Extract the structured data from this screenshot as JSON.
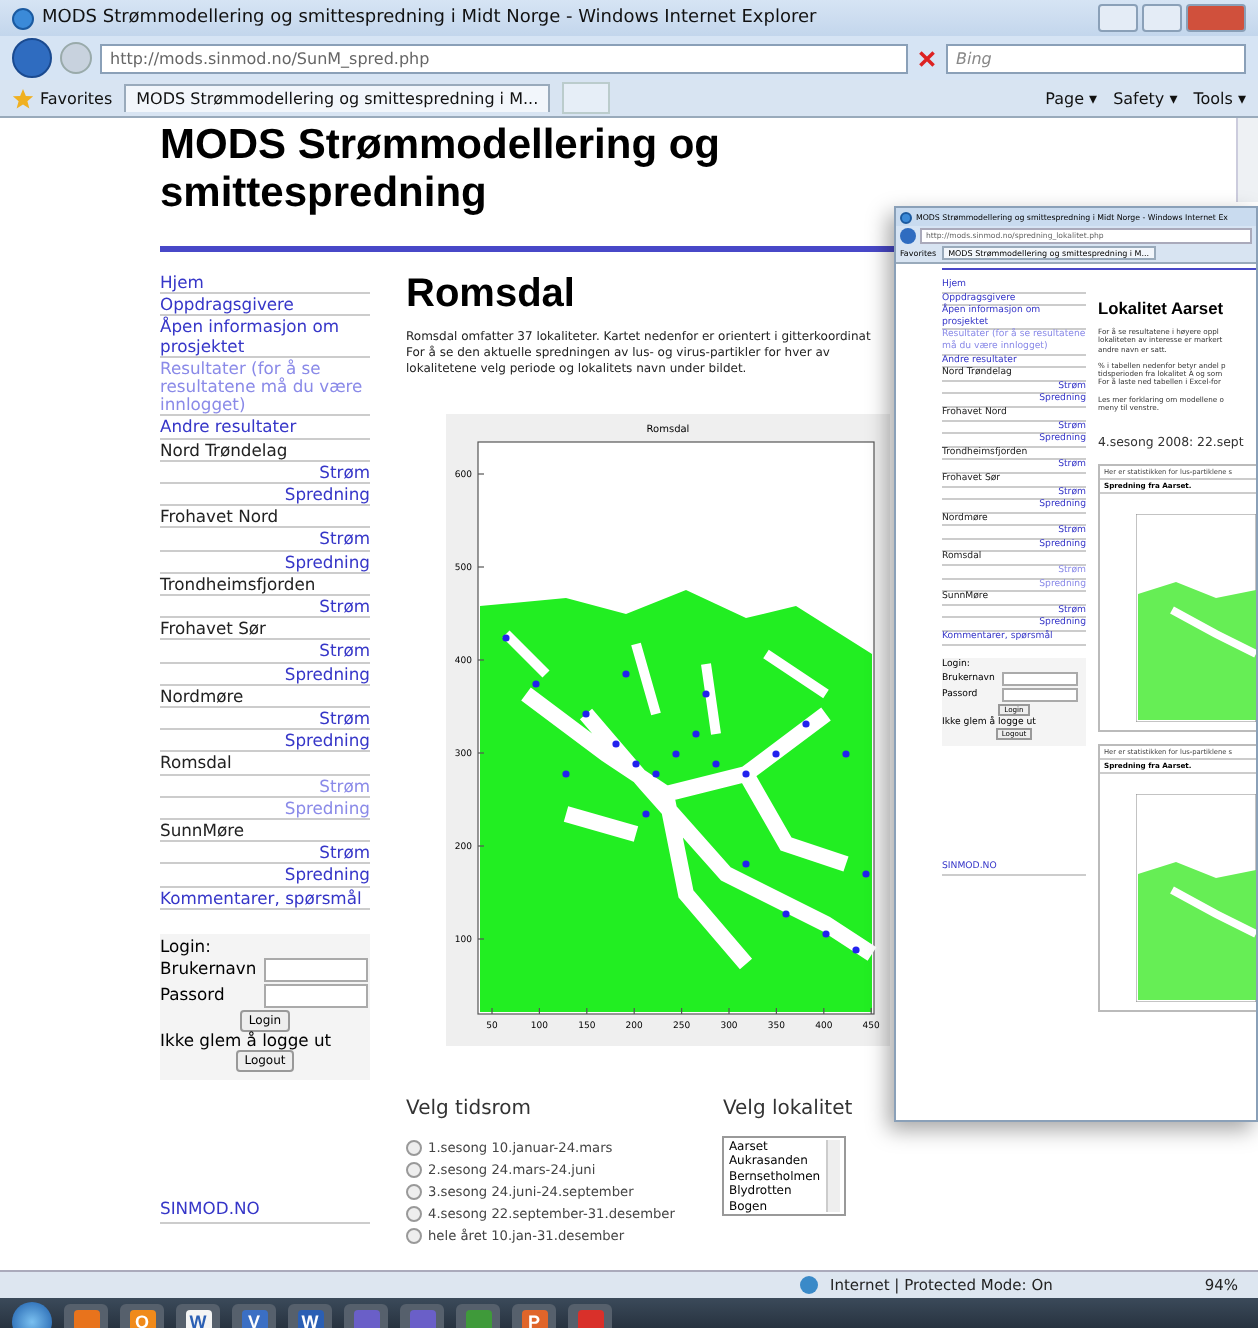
{
  "window": {
    "title": "MODS Strømmodellering og smittespredning i Midt Norge - Windows Internet Explorer",
    "address": "http://mods.sinmod.no/SunM_spred.php",
    "search_placeholder": "Bing",
    "favorites": "Favorites",
    "tab": "MODS Strømmodellering og smittespredning i M...",
    "commands": [
      "Page ▾",
      "Safety ▾",
      "Tools ▾"
    ]
  },
  "page": {
    "site_title": "MODS Strømmodellering og smittespredning",
    "sidebar": {
      "items": [
        {
          "label": "Hjem",
          "kind": "link",
          "visited": false
        },
        {
          "label": "Oppdragsgivere",
          "kind": "link",
          "visited": false
        },
        {
          "label": "Åpen informasjon om prosjektet",
          "kind": "link",
          "visited": false
        },
        {
          "label": "Resultater (for å se resultatene må du være innlogget)",
          "kind": "link",
          "visited": true
        },
        {
          "label": "Andre resultater",
          "kind": "link",
          "visited": false
        },
        {
          "label": "Nord Trøndelag",
          "kind": "section",
          "visited": false
        },
        {
          "label": "Strøm",
          "kind": "sub",
          "visited": false
        },
        {
          "label": "Spredning",
          "kind": "sub",
          "visited": false
        },
        {
          "label": "Frohavet Nord",
          "kind": "section",
          "visited": false
        },
        {
          "label": "Strøm",
          "kind": "sub",
          "visited": false
        },
        {
          "label": "Spredning",
          "kind": "sub",
          "visited": false
        },
        {
          "label": "Trondheimsfjorden",
          "kind": "section",
          "visited": false
        },
        {
          "label": "Strøm",
          "kind": "sub",
          "visited": false
        },
        {
          "label": "Frohavet Sør",
          "kind": "section",
          "visited": false
        },
        {
          "label": "Strøm",
          "kind": "sub",
          "visited": false
        },
        {
          "label": "Spredning",
          "kind": "sub",
          "visited": false
        },
        {
          "label": "Nordmøre",
          "kind": "section",
          "visited": false
        },
        {
          "label": "Strøm",
          "kind": "sub",
          "visited": false
        },
        {
          "label": "Spredning",
          "kind": "sub",
          "visited": false
        },
        {
          "label": "Romsdal",
          "kind": "section",
          "visited": false
        },
        {
          "label": "Strøm",
          "kind": "sub",
          "visited": true
        },
        {
          "label": "Spredning",
          "kind": "sub",
          "visited": true
        },
        {
          "label": "SunnMøre",
          "kind": "section",
          "visited": false
        },
        {
          "label": "Strøm",
          "kind": "sub",
          "visited": false
        },
        {
          "label": "Spredning",
          "kind": "sub",
          "visited": false
        },
        {
          "label": "Kommentarer, spørsmål",
          "kind": "link",
          "visited": false
        }
      ]
    },
    "login": {
      "title": "Login:",
      "username_label": "Brukernavn",
      "password_label": "Passord",
      "login_button": "Login",
      "reminder": "Ikke glem å logge ut",
      "logout_button": "Logout"
    },
    "footer_link": "SINMOD.NO",
    "heading": "Romsdal",
    "intro": [
      "Romsdal omfatter 37 lokaliteter. Kartet nedenfor er orientert i gitterkoordinat",
      "For å se den aktuelle spredningen av lus- og virus-partikler for hver av",
      "lokalitetene velg periode og lokalitets navn under bildet."
    ],
    "map": {
      "title": "Romsdal",
      "x_ticks": [
        "50",
        "100",
        "150",
        "200",
        "250",
        "300",
        "350",
        "400",
        "450"
      ],
      "y_ticks": [
        "600",
        "500",
        "400",
        "300",
        "200",
        "100"
      ]
    },
    "period": {
      "title": "Velg tidsrom",
      "options": [
        {
          "label": "1.sesong 10.januar-24.mars",
          "selected": false
        },
        {
          "label": "2.sesong 24.mars-24.juni",
          "selected": false
        },
        {
          "label": "3.sesong 24.juni-24.september",
          "selected": false
        },
        {
          "label": "4.sesong 22.september-31.desember",
          "selected": false
        },
        {
          "label": "hele året 10.jan-31.desember",
          "selected": false
        }
      ]
    },
    "locality": {
      "title": "Velg lokalitet",
      "options": [
        {
          "label": "Aarset",
          "selected": false
        },
        {
          "label": "Aukrasanden",
          "selected": false
        },
        {
          "label": "Bernsetholmen",
          "selected": false
        },
        {
          "label": "Blydrotten",
          "selected": false
        },
        {
          "label": "Bogen",
          "selected": false
        }
      ]
    }
  },
  "status_bar": {
    "zone": "Internet | Protected Mode: On",
    "zoom": "94%"
  },
  "inner_window": {
    "title": "MODS Strømmodellering og smittespredning i Midt Norge - Windows Internet Ex",
    "address": "http://mods.sinmod.no/spredning_lokalitet.php",
    "favorites": "Favorites",
    "tab": "MODS Strømmodellering og smittespredning i M...",
    "sidebar": {
      "items": [
        {
          "label": "Hjem",
          "kind": "link",
          "visited": false
        },
        {
          "label": "Oppdragsgivere",
          "kind": "link",
          "visited": false
        },
        {
          "label": "Åpen informasjon om prosjektet",
          "kind": "link",
          "visited": false
        },
        {
          "label": "Resultater (for å se resultatene må du være innlogget)",
          "kind": "link",
          "visited": true
        },
        {
          "label": "Andre resultater",
          "kind": "link",
          "visited": false
        },
        {
          "label": "Nord Trøndelag",
          "kind": "section",
          "visited": false
        },
        {
          "label": "Strøm",
          "kind": "sub",
          "visited": false
        },
        {
          "label": "Spredning",
          "kind": "sub",
          "visited": false
        },
        {
          "label": "Frohavet Nord",
          "kind": "section",
          "visited": false
        },
        {
          "label": "Strøm",
          "kind": "sub",
          "visited": false
        },
        {
          "label": "Spredning",
          "kind": "sub",
          "visited": false
        },
        {
          "label": "Trondheimsfjorden",
          "kind": "section",
          "visited": false
        },
        {
          "label": "Strøm",
          "kind": "sub",
          "visited": false
        },
        {
          "label": "Frohavet Sør",
          "kind": "section",
          "visited": false
        },
        {
          "label": "Strøm",
          "kind": "sub",
          "visited": false
        },
        {
          "label": "Spredning",
          "kind": "sub",
          "visited": false
        },
        {
          "label": "Nordmøre",
          "kind": "section",
          "visited": false
        },
        {
          "label": "Strøm",
          "kind": "sub",
          "visited": false
        },
        {
          "label": "Spredning",
          "kind": "sub",
          "visited": false
        },
        {
          "label": "Romsdal",
          "kind": "section",
          "visited": false
        },
        {
          "label": "Strøm",
          "kind": "sub",
          "visited": true
        },
        {
          "label": "Spredning",
          "kind": "sub",
          "visited": true
        },
        {
          "label": "SunnMøre",
          "kind": "section",
          "visited": false
        },
        {
          "label": "Strøm",
          "kind": "sub",
          "visited": false
        },
        {
          "label": "Spredning",
          "kind": "sub",
          "visited": false
        },
        {
          "label": "Kommentarer, spørsmål",
          "kind": "link",
          "visited": false
        }
      ]
    },
    "login": {
      "title": "Login:",
      "username_label": "Brukernavn",
      "password_label": "Passord",
      "login_button": "Login",
      "reminder": "Ikke glem å logge ut",
      "logout_button": "Logout"
    },
    "footer_link": "SINMOD.NO",
    "heading": "Lokalitet Aarset",
    "paragraphs": [
      [
        "For å se resultatene i høyere oppl",
        "lokaliteten av interesse er markert",
        "andre navn er satt."
      ],
      [
        "% i tabellen nedenfor betyr andel p",
        "tidsperioden fra lokalitet A og som",
        "For å laste ned tabellen i Excel-for"
      ],
      [
        "Les mer forklaring om modellene o",
        "meny til venstre."
      ]
    ],
    "season": "4.sesong 2008: 22.sept",
    "panels": [
      {
        "note": "Her er statistikken for lus-partiklene s",
        "caption": "Spredning fra Aarset."
      },
      {
        "note": "Her er statistikken for lus-partiklene s",
        "caption": "Spredning fra Aarset."
      }
    ]
  },
  "taskbar": {
    "apps": [
      {
        "color": "#e8731c"
      },
      {
        "color": "#f08a1a",
        "glyph": "O"
      },
      {
        "color": "#f4f4f4",
        "glyph": "W"
      },
      {
        "color": "#3b6fc4",
        "glyph": "V"
      },
      {
        "color": "#2b5fb4",
        "glyph": "W"
      },
      {
        "color": "#6a5fc8"
      },
      {
        "color": "#6a5fc8"
      },
      {
        "color": "#3f9a3a"
      },
      {
        "color": "#e0652a",
        "glyph": "P"
      },
      {
        "color": "#d9302a"
      }
    ]
  }
}
